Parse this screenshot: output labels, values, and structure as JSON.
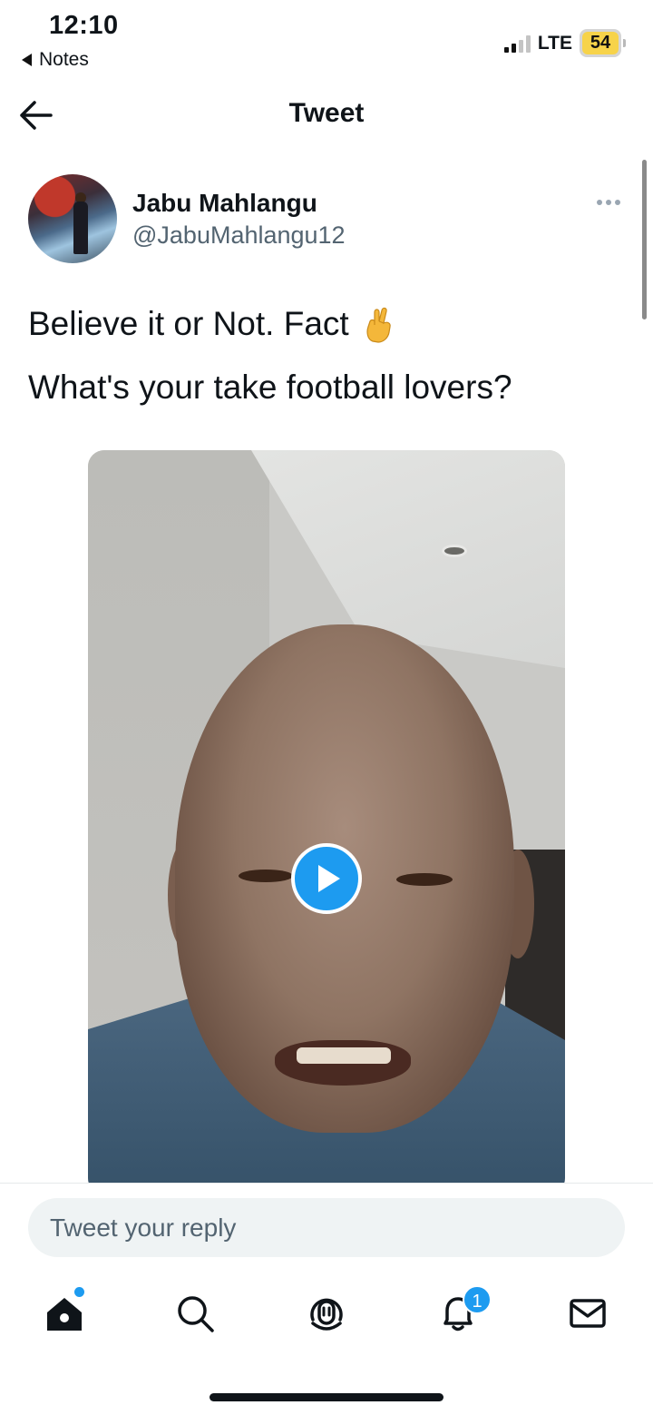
{
  "status_bar": {
    "time": "12:10",
    "back_app": "Notes",
    "network": "LTE",
    "battery": "54"
  },
  "header": {
    "title": "Tweet"
  },
  "tweet": {
    "author_name": "Jabu Mahlangu",
    "author_handle": "@JabuMahlangu12",
    "line1": "Believe it or Not. Fact",
    "line1_emoji": "crossed-fingers",
    "line2": "What's your take football lovers?",
    "media": {
      "type": "video",
      "play_icon": "play-icon"
    }
  },
  "reply": {
    "placeholder": "Tweet your reply"
  },
  "tabbar": {
    "items": [
      "home-icon",
      "search-icon",
      "spaces-icon",
      "notifications-icon",
      "messages-icon"
    ],
    "notifications_badge": "1"
  },
  "colors": {
    "accent": "#1d9bf0",
    "text": "#0f1419",
    "secondary_text": "#536471"
  }
}
